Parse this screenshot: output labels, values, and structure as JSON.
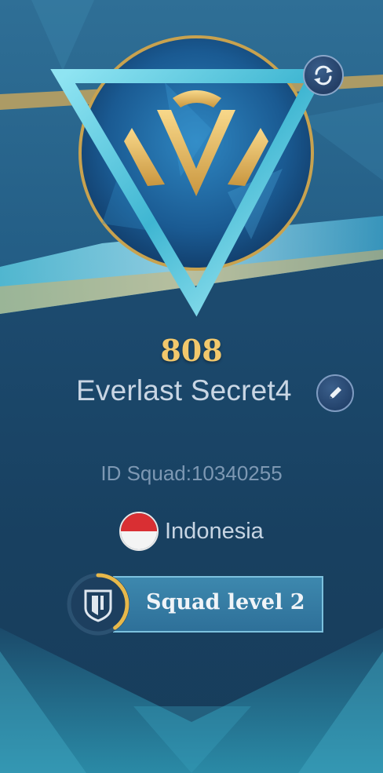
{
  "profile": {
    "score": "808",
    "name": "Everlast Secret4",
    "squad_id": "ID Squad:10340255",
    "country": "Indonesia",
    "squad_level_label": "Squad level 2",
    "squad_level_progress": 0.4
  },
  "icons": {
    "emblem": "rank-emblem-icon",
    "refresh": "refresh-icon",
    "edit": "pencil-icon",
    "flag": "indonesia-flag-icon",
    "squad": "squad-shield-icon"
  },
  "colors": {
    "score_gold": "#f2c86c",
    "accent_cyan": "#7cc1de",
    "progress_gold": "#e7b84a"
  }
}
